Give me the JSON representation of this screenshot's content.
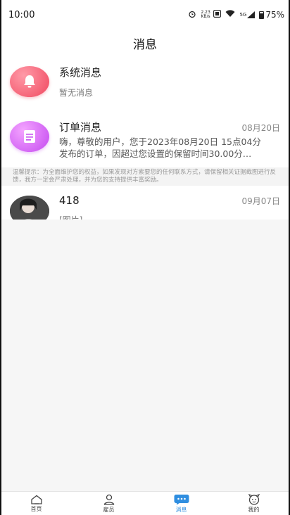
{
  "status_bar": {
    "time": "10:00",
    "network_speed": "2.23\nKB/s",
    "signal": "5G",
    "battery": "75%"
  },
  "header": {
    "title": "消息"
  },
  "messages": {
    "system": {
      "title": "系统消息",
      "subtitle": "暂无消息",
      "icon": "bell-icon",
      "color": "#f0485f"
    },
    "order": {
      "title": "订单消息",
      "date": "08月20日",
      "preview_line1": "嗨，尊敬的用户，您于2023年08月20日 15点04分",
      "preview_line2": "发布的订单，因超过您设置的保留时间30.00分…",
      "icon": "document-icon",
      "color": "#c44af0"
    },
    "notice": "温馨提示：为全面维护您的权益，如果发现对方索要您的任何联系方式，请保留相关证据截图进行反馈，我方一定会严肃处理，并为您的支持提供丰富奖励。",
    "chat": {
      "name": "418",
      "date": "09月07日",
      "preview": "[图片]"
    }
  },
  "tabbar": {
    "items": [
      {
        "label": "首页",
        "icon": "home-icon"
      },
      {
        "label": "雇员",
        "icon": "user-icon"
      },
      {
        "label": "消息",
        "icon": "message-icon",
        "active": true
      },
      {
        "label": "我的",
        "icon": "profile-face-icon"
      }
    ],
    "active_color": "#2f8ee0"
  }
}
